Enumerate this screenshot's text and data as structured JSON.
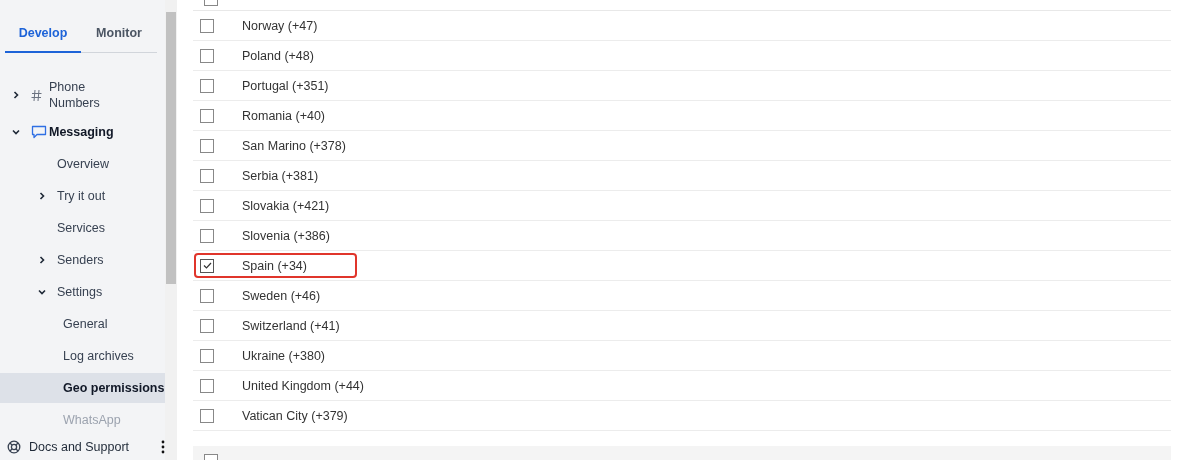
{
  "tabs": [
    {
      "label": "Develop",
      "selected": true
    },
    {
      "label": "Monitor",
      "selected": false
    }
  ],
  "nav": [
    {
      "label": "Phone Numbers",
      "expanded": false
    },
    {
      "label": "Messaging",
      "expanded": true,
      "children": [
        {
          "label": "Overview",
          "selected": false
        },
        {
          "label": "Try it out",
          "expanded": false
        },
        {
          "label": "Services",
          "selected": false
        },
        {
          "label": "Senders",
          "expanded": false
        },
        {
          "label": "Settings",
          "expanded": true,
          "children": [
            {
              "label": "General",
              "selected": false
            },
            {
              "label": "Log archives",
              "selected": false
            },
            {
              "label": "Geo permissions",
              "selected": true
            },
            {
              "label": "WhatsApp",
              "selected": false,
              "disabled": true
            }
          ]
        }
      ]
    }
  ],
  "footer": {
    "label": "Docs and Support"
  },
  "countries": [
    {
      "label": "Norway (+47)",
      "checked": false,
      "highlighted": false
    },
    {
      "label": "Poland (+48)",
      "checked": false,
      "highlighted": false
    },
    {
      "label": "Portugal (+351)",
      "checked": false,
      "highlighted": false
    },
    {
      "label": "Romania (+40)",
      "checked": false,
      "highlighted": false
    },
    {
      "label": "San Marino (+378)",
      "checked": false,
      "highlighted": false
    },
    {
      "label": "Serbia (+381)",
      "checked": false,
      "highlighted": false
    },
    {
      "label": "Slovakia (+421)",
      "checked": false,
      "highlighted": false
    },
    {
      "label": "Slovenia (+386)",
      "checked": false,
      "highlighted": false
    },
    {
      "label": "Spain (+34)",
      "checked": true,
      "highlighted": true
    },
    {
      "label": "Sweden (+46)",
      "checked": false,
      "highlighted": false
    },
    {
      "label": "Switzerland (+41)",
      "checked": false,
      "highlighted": false
    },
    {
      "label": "Ukraine (+380)",
      "checked": false,
      "highlighted": false
    },
    {
      "label": "United Kingdom (+44)",
      "checked": false,
      "highlighted": false
    },
    {
      "label": "Vatican City (+379)",
      "checked": false,
      "highlighted": false
    }
  ]
}
